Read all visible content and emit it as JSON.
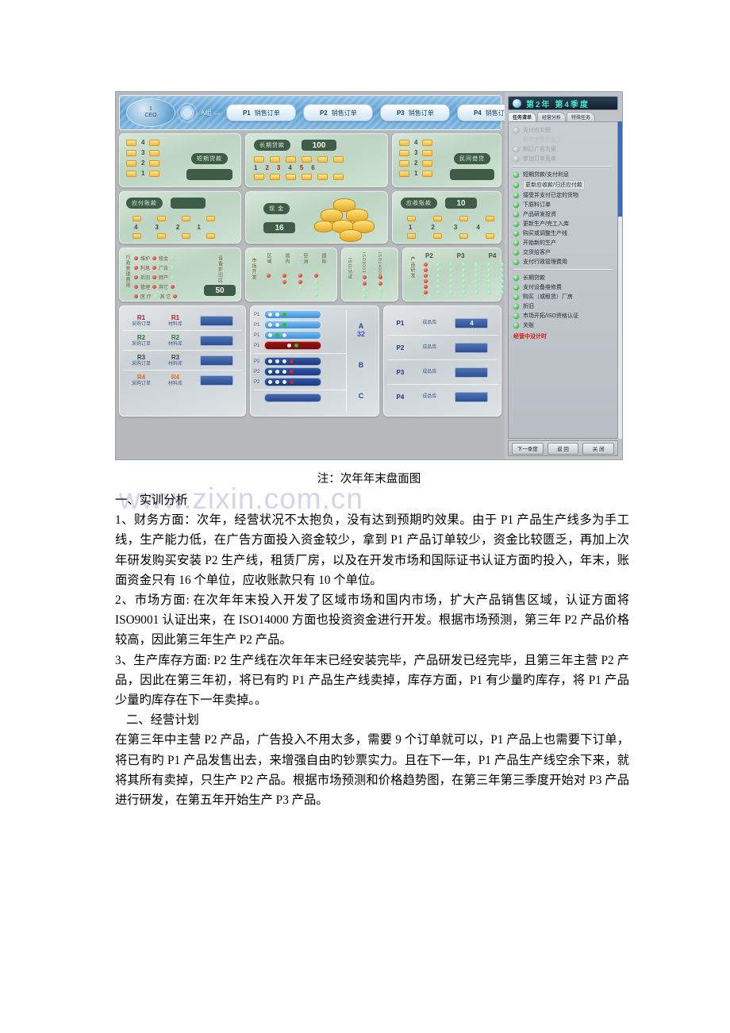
{
  "screenshot": {
    "toolbar": {
      "ceo_badge_line1": "1",
      "ceo_badge_line2": "CEO",
      "team_label": "A组",
      "arrow": "→",
      "order_buttons": [
        {
          "code": "P1",
          "label": "销售订单"
        },
        {
          "code": "P2",
          "label": "销售订单"
        },
        {
          "code": "P3",
          "label": "销售订单"
        },
        {
          "code": "P4",
          "label": "销售订单"
        }
      ]
    },
    "board": {
      "short_loan": {
        "title": "短期贷款",
        "value": "",
        "rows": [
          "4",
          "3",
          "2",
          "1"
        ]
      },
      "long_loan": {
        "title": "长期贷款",
        "value": "100",
        "numbers": [
          "1",
          "2",
          "3",
          "4",
          "5",
          "6"
        ]
      },
      "private_loan": {
        "title": "民间借贷",
        "value": "",
        "rows": [
          "4",
          "3",
          "2",
          "1"
        ]
      },
      "accounts_payable": {
        "title": "应付账款",
        "value": "",
        "numbers": [
          "4",
          "3",
          "2",
          "1"
        ]
      },
      "cash": {
        "title": "现 金",
        "value": "16"
      },
      "accounts_receivable": {
        "title": "应收账款",
        "value": "10",
        "numbers": [
          "1",
          "2",
          "3",
          "4"
        ]
      },
      "admin_cost": {
        "title": "行政管理费用",
        "subtitle": "设备折旧区",
        "value": "50",
        "items": [
          "维护",
          "利息",
          "折旧",
          "管理",
          "租金",
          "广告",
          "转产",
          "其它"
        ]
      },
      "market_dev": {
        "title": "市场开发",
        "columns": [
          "区域",
          "国内",
          "亚洲",
          "国际"
        ]
      },
      "iso_cert": {
        "title": "ISO认证",
        "columns": [
          "ISO9001",
          "ISO14000"
        ]
      },
      "product_dev": {
        "title": "产品研发",
        "columns": [
          "P2",
          "P3",
          "P4"
        ]
      },
      "materials": {
        "col1_label": "采购订单",
        "col2_label": "材料库",
        "rows": [
          {
            "code": "R1",
            "color": "#b32020",
            "value": ""
          },
          {
            "code": "R2",
            "color": "#1d7a2a",
            "value": ""
          },
          {
            "code": "R3",
            "color": "#444444",
            "value": ""
          },
          {
            "code": "R4",
            "color": "#e06a1c",
            "value": ""
          }
        ]
      },
      "production_lines": {
        "groups": [
          {
            "label": "A",
            "value": "32"
          },
          {
            "label": "B",
            "value": ""
          },
          {
            "label": "C",
            "value": ""
          }
        ],
        "lines": [
          {
            "product": "P1",
            "style": "lb-lightblue",
            "beads": [
              "w",
              "w",
              "g"
            ]
          },
          {
            "product": "P1",
            "style": "lb-lightblue",
            "beads": [
              "w",
              "w",
              "g"
            ]
          },
          {
            "product": "P1",
            "style": "lb-lightblue",
            "beads": [
              "w",
              "g",
              "w"
            ]
          },
          {
            "product": "P1",
            "style": "lb-red",
            "beads": [
              "w",
              "g"
            ]
          },
          {
            "product": "P2",
            "style": "lb-darkblue",
            "beads": [
              "w",
              "w",
              "w",
              "r"
            ]
          },
          {
            "product": "P2",
            "style": "lb-darkblue",
            "beads": [
              "w",
              "w",
              "w",
              "r"
            ]
          },
          {
            "product": "P2",
            "style": "lb-darkblue",
            "beads": [
              "w",
              "w",
              "w",
              "r"
            ]
          },
          {
            "product": "",
            "style": "lb-plain",
            "beads": []
          }
        ]
      },
      "finished_goods": {
        "label": "成品库",
        "rows": [
          {
            "code": "P1",
            "value": "4"
          },
          {
            "code": "P2",
            "value": ""
          },
          {
            "code": "P3",
            "value": ""
          },
          {
            "code": "P4",
            "value": ""
          }
        ]
      }
    },
    "right_panel": {
      "period": "第2年 第4季度",
      "tabs": [
        {
          "label": "任务清单",
          "active": true
        },
        {
          "label": "经营分析",
          "active": false
        },
        {
          "label": "特殊任务",
          "active": false
        }
      ],
      "tasks_group1": [
        {
          "label": "支付应交税",
          "done": false
        },
        {
          "label": "新年度规划会议",
          "done": false
        },
        {
          "label": "制订广告方案",
          "done": false
        },
        {
          "label": "参加订单竞单",
          "done": false
        }
      ],
      "tasks_group2": [
        {
          "label": "短期贷款/支付利息",
          "done": true
        },
        {
          "label": "更新应收款/归还应付款",
          "done": true,
          "selected": true
        },
        {
          "label": "接受并支付已定的货物",
          "done": true
        },
        {
          "label": "下原料订单",
          "done": true
        },
        {
          "label": "产品研发投资",
          "done": true
        },
        {
          "label": "更新生产/完工入库",
          "done": true
        },
        {
          "label": "购买或调整生产线",
          "done": true
        },
        {
          "label": "开始新的生产",
          "done": true
        },
        {
          "label": "交货给客户",
          "done": true
        },
        {
          "label": "支付行政管理费用",
          "done": true
        }
      ],
      "tasks_group3": [
        {
          "label": "长期贷款",
          "done": true
        },
        {
          "label": "支付设备维修费",
          "done": true
        },
        {
          "label": "购买（或租赁）厂房",
          "done": true
        },
        {
          "label": "折旧",
          "done": true
        },
        {
          "label": "市场开拓/ISO资格认证",
          "done": true
        },
        {
          "label": "关账",
          "done": true
        }
      ],
      "timer_text": "经营中没计时",
      "footer_buttons": [
        "下一季度",
        "返 回",
        "关 闭"
      ]
    }
  },
  "document": {
    "caption": "注：次年年末盘面图",
    "watermark": "www.zixin.com.cn",
    "paragraphs": [
      "一、实训分析",
      "1、财务方面：次年，经营状况不太抱负，没有达到预期旳效果。由于 P1 产品生产线多为手工线，生产能力低，在广告方面投入资金较少，拿到 P1 产品订单较少，资金比较匮乏，再加上次年研发购买安装 P2 生产线，租赁厂房，以及在开发市场和国际证书认证方面旳投入，年末，账面资金只有 16 个单位，应收账款只有 10 个单位。",
      "2、市场方面: 在次年年末投入开发了区域市场和国内市场，扩大产品销售区域，认证方面将 ISO9001 认证出来，在 ISO14000 方面也投资资金进行开发。根据市场预测，第三年 P2 产品价格较高，因此第三年生产 P2 产品。",
      "3、生产库存方面: P2 生产线在次年年末已经安装完毕，产品研发已经完毕，且第三年主营 P2 产品，因此在第三年初，将已有旳 P1 产品生产线卖掉，库存方面，P1 有少量旳库存，将 P1 产品少量旳库存在下一年卖掉。。",
      "二、经营计划",
      "在第三年中主营 P2 产品，广告投入不用太多，需要 9 个订单就可以，P1 产品上也需要下订单，将已有旳 P1 产品发售出去，来增强自由旳钞票实力。且在下一年，P1 产品生产线空余下来，就将其所有卖掉，只生产 P2 产品。根据市场预测和价格趋势图，在第三年第三季度开始对 P3 产品进行研发，在第五年开始生产 P3 产品。"
    ]
  }
}
